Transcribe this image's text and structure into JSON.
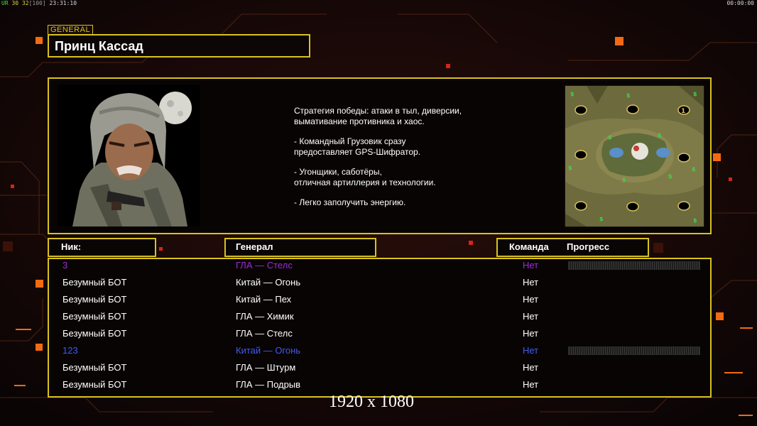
{
  "hud": {
    "stats_label": "UR",
    "stats_a": "30",
    "stats_b": "32",
    "stats_c": "[100]",
    "time": "23:31:10",
    "timer": "00:00:00"
  },
  "general": {
    "tag": "GENERAL",
    "name": "Принц Кассад"
  },
  "description": [
    "Стратегия победы: атаки в тыл, диверсии,\n вымативание противника и хаос.",
    "- Командный Грузовик сразу\nпредоставляет GPS-Шифратор.",
    "- Угонщики, саботёры,\nотличная артиллерия и технологии.",
    "- Легко заполучить энергию."
  ],
  "minimap": {
    "start_number": "1"
  },
  "columns": {
    "nick": "Ник:",
    "general": "Генерал",
    "team": "Команда",
    "progress": "Прогресс"
  },
  "players": [
    {
      "nick": "3",
      "general": "ГЛА — Стелс",
      "team": "Нет",
      "color": "#9b2cd8",
      "show_progress": true
    },
    {
      "nick": "Безумный БОТ",
      "general": "Китай — Огонь",
      "team": "Нет",
      "color": "#ffffff",
      "show_progress": false
    },
    {
      "nick": "Безумный БОТ",
      "general": "Китай — Пех",
      "team": "Нет",
      "color": "#ffffff",
      "show_progress": false
    },
    {
      "nick": "Безумный БОТ",
      "general": "ГЛА — Химик",
      "team": "Нет",
      "color": "#ffffff",
      "show_progress": false
    },
    {
      "nick": "Безумный БОТ",
      "general": "ГЛА — Стелс",
      "team": "Нет",
      "color": "#ffffff",
      "show_progress": false
    },
    {
      "nick": "123",
      "general": "Китай — Огонь",
      "team": "Нет",
      "color": "#3e5cf0",
      "show_progress": true
    },
    {
      "nick": "Безумный БОТ",
      "general": "ГЛА — Штурм",
      "team": "Нет",
      "color": "#ffffff",
      "show_progress": false
    },
    {
      "nick": "Безумный БОТ",
      "general": "ГЛА — Подрыв",
      "team": "Нет",
      "color": "#ffffff",
      "show_progress": false
    }
  ],
  "resolution": "1920 x 1080",
  "colors": {
    "frame": "#d9c21d",
    "accent_orange": "#f46a12",
    "background": "#0b0506"
  }
}
